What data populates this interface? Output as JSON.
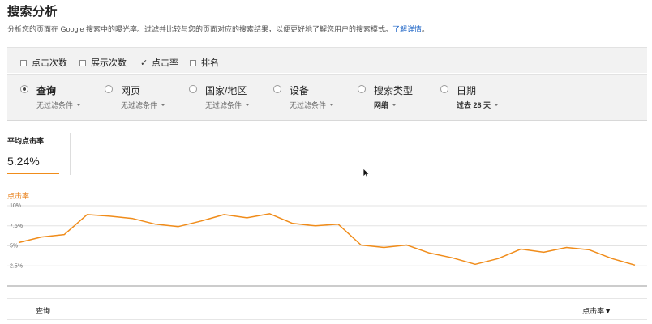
{
  "header": {
    "title": "搜索分析",
    "description": "分析您的页面在 Google 搜索中的曝光率。过滤并比较与您的页面对应的搜索结果，以便更好地了解您用户的搜索模式。",
    "learn_more": "了解详情",
    "learn_more_suffix": "。"
  },
  "metrics": [
    {
      "label": "点击次数",
      "checked": false
    },
    {
      "label": "展示次数",
      "checked": false
    },
    {
      "label": "点击率",
      "checked": true
    },
    {
      "label": "排名",
      "checked": false
    }
  ],
  "dimensions": [
    {
      "label": "查询",
      "filter": "无过滤条件",
      "selected": true
    },
    {
      "label": "网页",
      "filter": "无过滤条件",
      "selected": false
    },
    {
      "label": "国家/地区",
      "filter": "无过滤条件",
      "selected": false
    },
    {
      "label": "设备",
      "filter": "无过滤条件",
      "selected": false
    },
    {
      "label": "搜索类型",
      "filter": "网络",
      "selected": false
    },
    {
      "label": "日期",
      "filter": "过去 28 天",
      "selected": false
    }
  ],
  "summary": {
    "label": "平均点击率",
    "value": "5.24%"
  },
  "chart_data": {
    "type": "line",
    "title": "",
    "series": [
      {
        "name": "点击率",
        "color": "#f08c1a",
        "values": [
          5.4,
          6.1,
          6.4,
          8.9,
          8.7,
          8.4,
          7.7,
          7.4,
          8.1,
          8.9,
          8.5,
          9.0,
          7.8,
          7.5,
          7.7,
          5.1,
          4.8,
          5.1,
          4.1,
          3.5,
          2.7,
          3.4,
          4.6,
          4.2,
          4.8,
          4.5,
          3.4,
          2.6
        ]
      }
    ],
    "yticks": [
      "10%",
      "7.5%",
      "5%",
      "2.5%"
    ],
    "ylim": [
      0,
      10
    ],
    "grid": true
  },
  "table": {
    "col_query": "查询",
    "col_ctr": "点击率▼"
  }
}
